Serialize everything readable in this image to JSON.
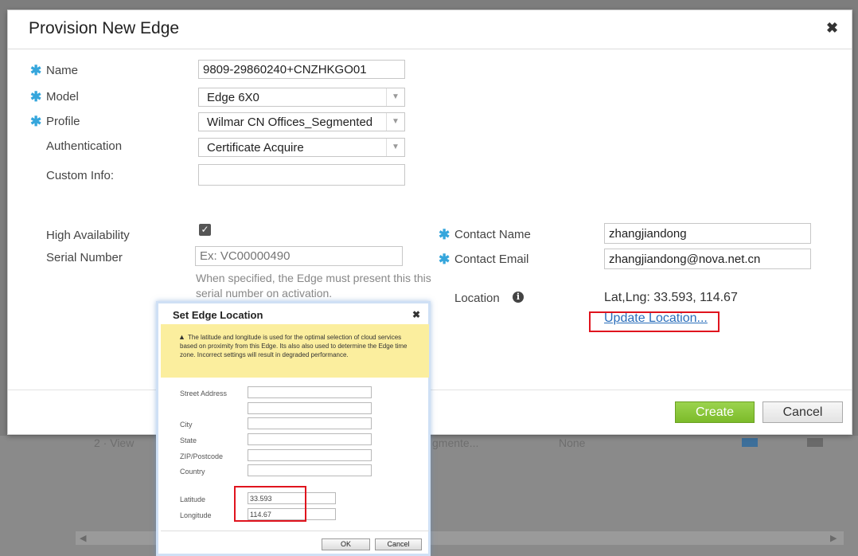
{
  "background": {
    "row_text": [
      "2 · View",
      "gmente...",
      "None"
    ]
  },
  "modal": {
    "title": "Provision New Edge",
    "close_icon": "close-icon",
    "fields": {
      "name_label": "Name",
      "name_value": "9809-29860240+CNZHKGO01",
      "model_label": "Model",
      "model_value": "Edge 6X0",
      "profile_label": "Profile",
      "profile_value": "Wilmar CN Offices_Segmented",
      "authentication_label": "Authentication",
      "authentication_value": "Certificate Acquire",
      "custom_info_label": "Custom Info:",
      "custom_info_value": "",
      "ha_label": "High Availability",
      "ha_checked": true,
      "serial_label": "Serial Number",
      "serial_placeholder": "Ex: VC00000490",
      "serial_help": "When specified, the Edge must present this this serial number on activation.",
      "contact_name_label": "Contact Name",
      "contact_name_value": "zhangjiandong",
      "contact_email_label": "Contact Email",
      "contact_email_value": "zhangjiandong@nova.net.cn",
      "location_label": "Location",
      "location_value": "Lat,Lng: 33.593, 114.67",
      "update_location_link": "Update Location..."
    },
    "buttons": {
      "create": "Create",
      "cancel": "Cancel"
    }
  },
  "location_dialog": {
    "title": "Set Edge Location",
    "warning": "The latitude and longitude is used for the optimal selection of cloud services based on proximity from this Edge. Its also also used to determine the Edge time zone. Incorrect settings will result in degraded performance.",
    "street_label": "Street Address",
    "city_label": "City",
    "state_label": "State",
    "zip_label": "ZIP/Postcode",
    "country_label": "Country",
    "latitude_label": "Latitude",
    "latitude_value": "33.593",
    "longitude_label": "Longitude",
    "longitude_value": "114.67",
    "ok": "OK",
    "cancel": "Cancel"
  },
  "colors": {
    "accent": "#35a6dc",
    "create_green": "#7cbb2a",
    "highlight_red": "#e0141e",
    "warning_yellow": "#fbee9e",
    "link": "#2a6ebb"
  }
}
